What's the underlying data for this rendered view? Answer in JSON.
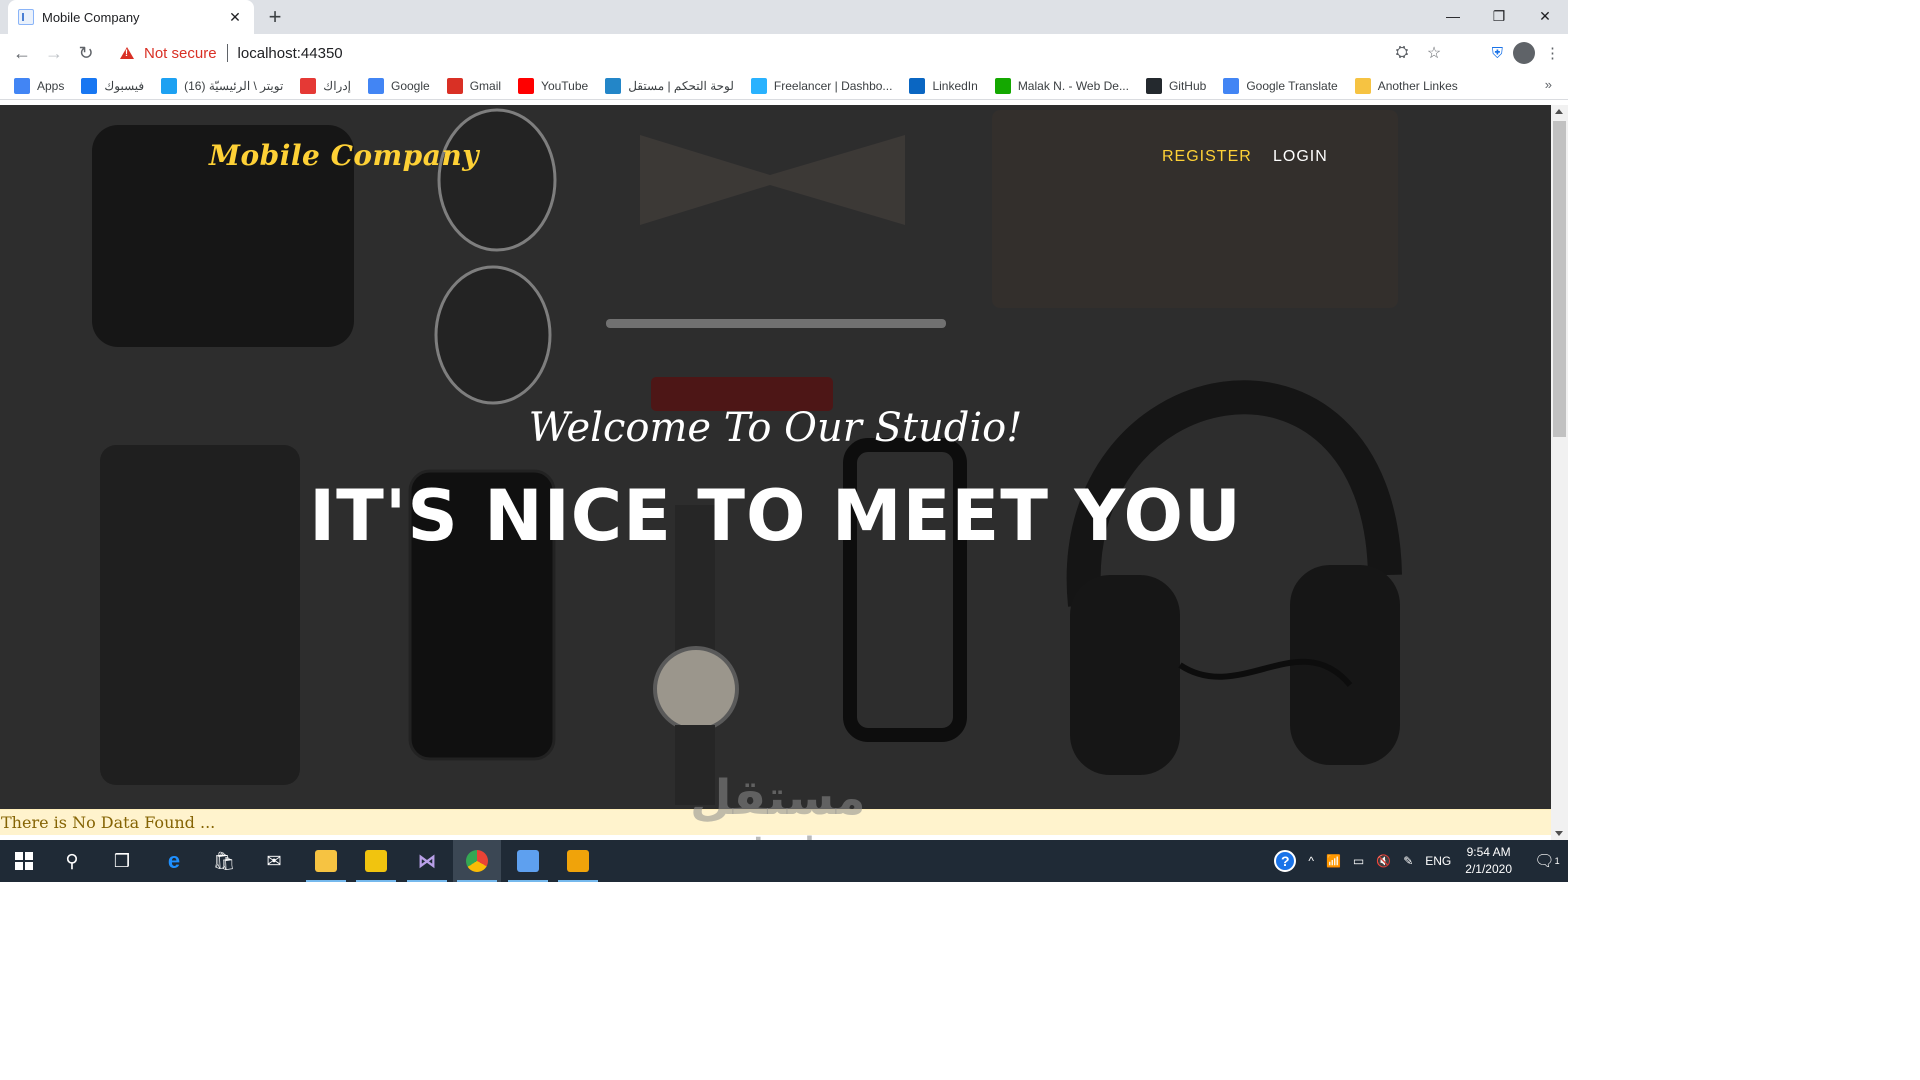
{
  "browser": {
    "tab_title": "Mobile Company",
    "tab_close": "✕",
    "new_tab": "+",
    "window_controls": {
      "minimize": "—",
      "maximize": "❐",
      "close": "✕"
    },
    "security_label": "Not secure",
    "url": "localhost:44350",
    "bookmarks": [
      {
        "label": "Apps",
        "icon": "apps-grid-icon",
        "color": "#4285f4"
      },
      {
        "label": "فيسبوك",
        "icon": "facebook-icon",
        "color": "#1877f2"
      },
      {
        "label": "(16) تويتر \\ الرئيسيّة",
        "icon": "twitter-icon",
        "color": "#1da1f2"
      },
      {
        "label": "إدراك",
        "icon": "edraak-icon",
        "color": "#e53935"
      },
      {
        "label": "Google",
        "icon": "google-icon",
        "color": "#4285f4"
      },
      {
        "label": "Gmail",
        "icon": "gmail-icon",
        "color": "#d93025"
      },
      {
        "label": "YouTube",
        "icon": "youtube-icon",
        "color": "#ff0000"
      },
      {
        "label": "لوحة التحكم | مستقل",
        "icon": "mostaql-icon",
        "color": "#2386c8"
      },
      {
        "label": "Freelancer | Dashbo...",
        "icon": "freelancer-icon",
        "color": "#29b2fe"
      },
      {
        "label": "LinkedIn",
        "icon": "linkedin-icon",
        "color": "#0a66c2"
      },
      {
        "label": "Malak N. - Web De...",
        "icon": "upwork-icon",
        "color": "#14a800"
      },
      {
        "label": "GitHub",
        "icon": "github-icon",
        "color": "#24292e"
      },
      {
        "label": "Google Translate",
        "icon": "translate-icon",
        "color": "#4285f4"
      },
      {
        "label": "Another Linkes",
        "icon": "folder-icon",
        "color": "#f6c342"
      }
    ],
    "bookmarks_overflow": "»"
  },
  "page": {
    "brand": "Mobile Company",
    "nav": {
      "register": "REGISTER",
      "login": "LOGIN"
    },
    "accent_color": "#fed136",
    "hero_subheading": "Welcome To Our Studio!",
    "hero_heading": "IT'S NICE TO MEET YOU",
    "alert": "There is No Data Found ..."
  },
  "watermark": {
    "arabic": "مستقل",
    "latin": "mostaql.com"
  },
  "taskbar": {
    "pinned": [
      {
        "name": "start-button",
        "icon": "windows-logo-icon"
      },
      {
        "name": "search-button",
        "icon": "search-icon"
      },
      {
        "name": "task-view-button",
        "icon": "task-view-icon"
      },
      {
        "name": "edge-app",
        "icon": "edge-icon",
        "color": "#1e90ff"
      },
      {
        "name": "store-app",
        "icon": "store-icon",
        "color": "#ffffff"
      },
      {
        "name": "mail-app",
        "icon": "mail-icon",
        "color": "#ffffff"
      },
      {
        "name": "file-explorer-app",
        "icon": "folder-icon",
        "color": "#f6c342"
      },
      {
        "name": "unknown-app",
        "icon": "app-icon",
        "color": "#f1c40f"
      },
      {
        "name": "visual-studio-app",
        "icon": "visual-studio-icon",
        "color": "#8661c5"
      },
      {
        "name": "chrome-app",
        "icon": "chrome-icon",
        "color": "#34a853"
      },
      {
        "name": "notes-app",
        "icon": "notes-icon",
        "color": "#5ea0ef"
      },
      {
        "name": "image-app",
        "icon": "photos-icon",
        "color": "#f0a30a"
      }
    ],
    "tray": {
      "language": "ENG",
      "time": "9:54 AM",
      "date": "2/1/2020",
      "notifications": "1"
    }
  }
}
